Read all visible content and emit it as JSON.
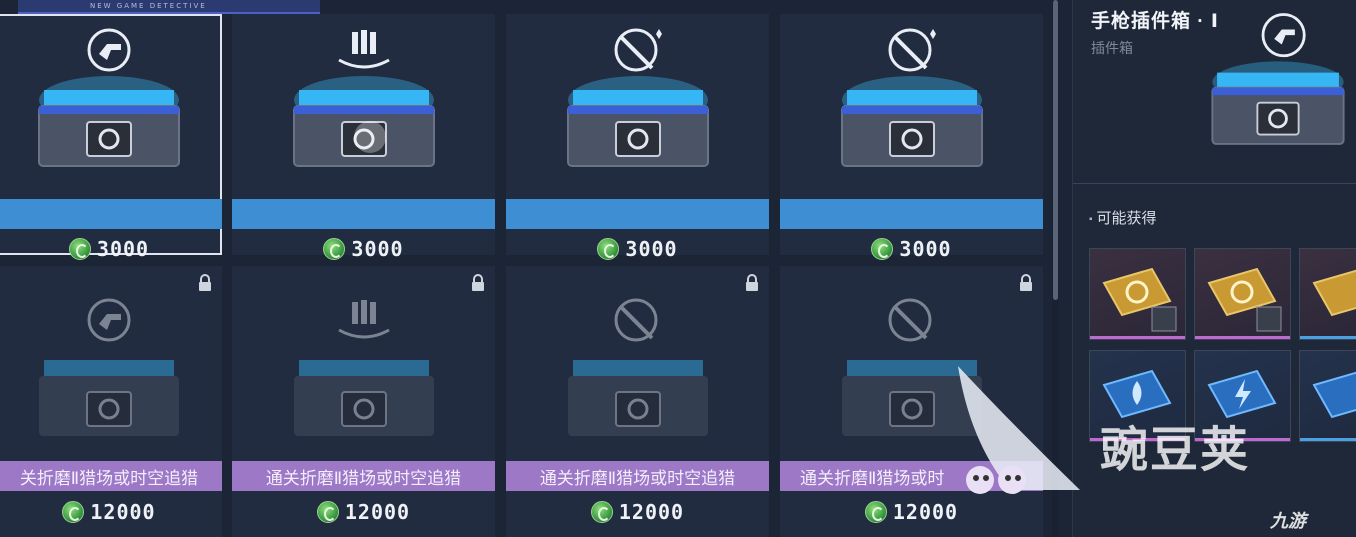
{
  "logo": {
    "tagline": "NEW GAME DETECTIVE"
  },
  "colors": {
    "buy_bar": "#3d8ed2",
    "lock_bar": "#9c78c7",
    "background": "#1c2536"
  },
  "row1": [
    {
      "icon": "pistol-icon",
      "price": "3000",
      "selected": true
    },
    {
      "icon": "ammo-icon",
      "price": "3000"
    },
    {
      "icon": "rifle-icon",
      "price": "3000"
    },
    {
      "icon": "rifle-icon",
      "price": "3000"
    }
  ],
  "row2": [
    {
      "icon": "pistol-icon",
      "unlock": "关折磨Ⅱ猎场或时空追猎",
      "price": "12000"
    },
    {
      "icon": "ammo-icon",
      "unlock": "通关折磨Ⅱ猎场或时空追猎",
      "price": "12000"
    },
    {
      "icon": "rifle-icon",
      "unlock": "通关折磨Ⅱ猎场或时空追猎",
      "price": "12000"
    },
    {
      "icon": "rifle-icon",
      "unlock": "通关折磨Ⅱ猎场或时",
      "price": "12000"
    }
  ],
  "panel": {
    "title": "手枪插件箱 · Ⅰ",
    "subtitle": "插件箱",
    "section_label": "可能获得"
  },
  "watermark": {
    "main": "豌豆荚",
    "corner": "九游"
  }
}
